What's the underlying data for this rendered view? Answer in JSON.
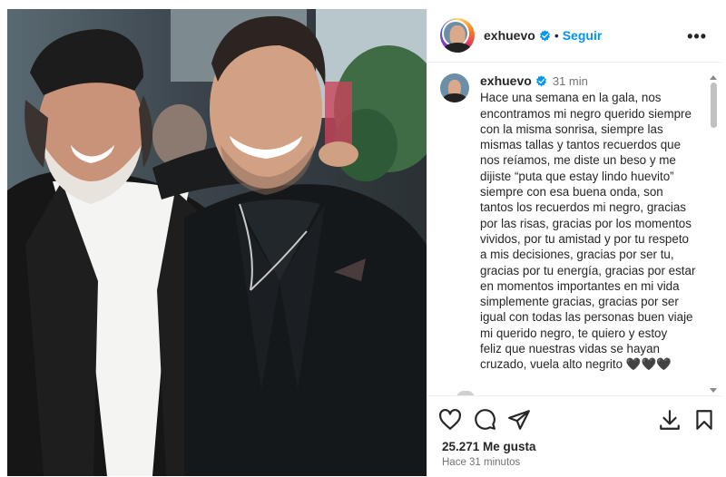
{
  "post": {
    "username": "exhuevo",
    "follow_label": "Seguir",
    "separator": "•",
    "more_label": "•••",
    "caption_time": "31 min",
    "caption": "Hace una semana en la gala, nos\nencontramos mi negro querido siempre\ncon la misma sonrisa, siempre las\nmismas tallas y tantos recuerdos que\nnos reíamos, me diste un beso y me\ndijiste “puta que estay lindo huevito”\nsiempre con esa buena onda, son\ntantos los recuerdos mi negro, gracias\npor las risas, gracias por los momentos\nvividos, por tu amistad y por tu respeto\na mis decisiones, gracias por ser tu,\ngracias por tu energía, gracias por estar\nen momentos importantes en mi vida\nsimplemente gracias, gracias por ser\nigual con todas las personas buen viaje\nmi querido negro, te quiero y estoy\nfeliz que nuestras vidas se hayan\ncruzado, vuela alto negrito 🖤🖤🖤",
    "likes": "25.271 Me gusta",
    "posted_ago": "Hace 31 minutos"
  },
  "icons": {
    "verified": "verified-badge-icon",
    "like": "heart-icon",
    "comment": "comment-icon",
    "share": "send-icon",
    "save": "bookmark-icon",
    "download": "download-icon"
  },
  "colors": {
    "accent": "#0095f6",
    "verified": "#0095f6",
    "text": "#262626",
    "muted": "#737373",
    "border": "#efefef"
  }
}
